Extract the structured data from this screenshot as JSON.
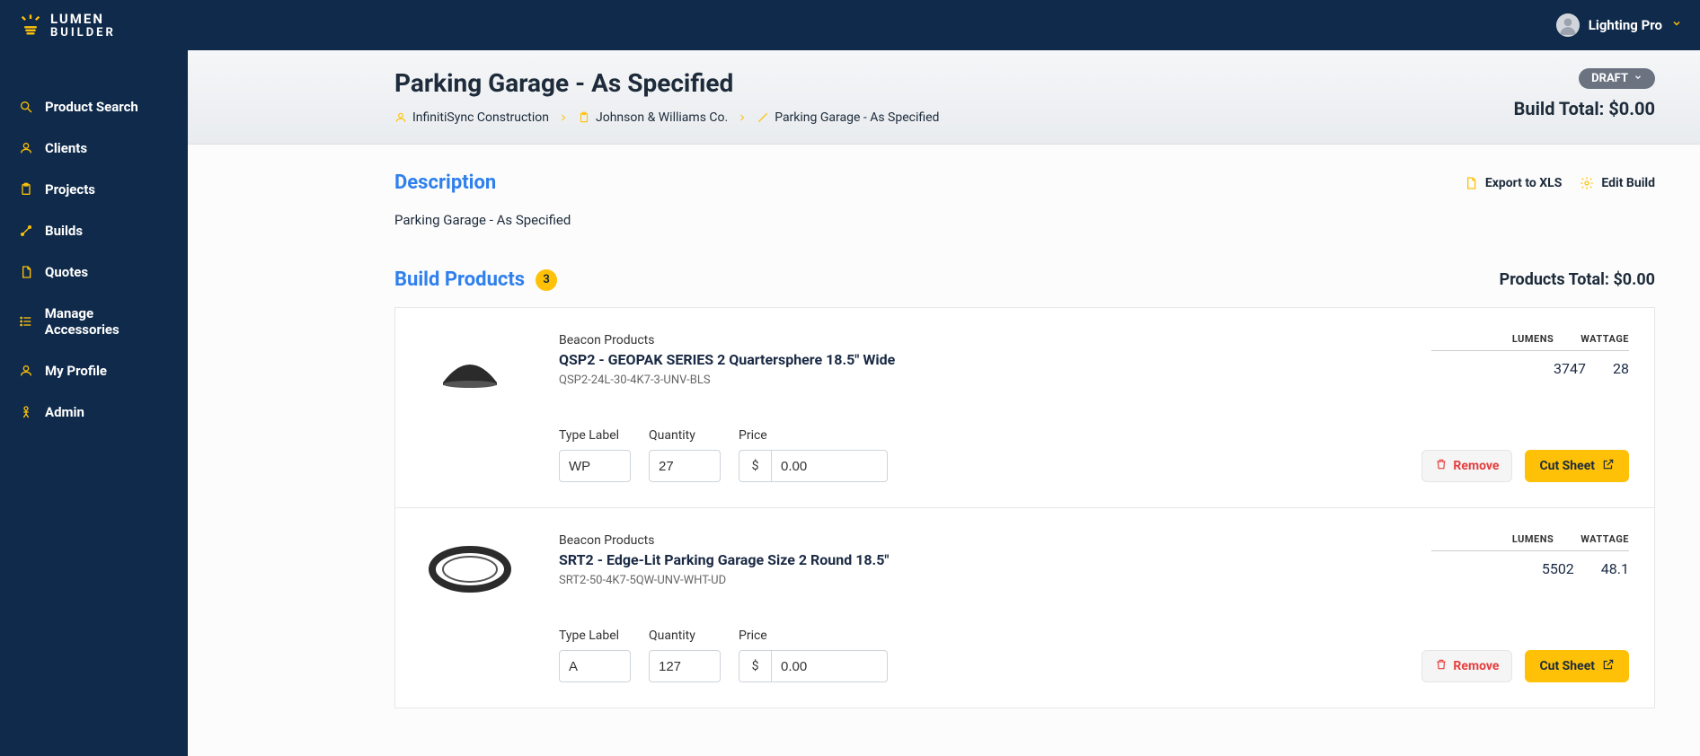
{
  "brand": {
    "line1": "LUMEN",
    "line2": "BUILDER"
  },
  "user": {
    "name": "Lighting Pro"
  },
  "sidebar": {
    "items": [
      {
        "label": "Product Search",
        "icon": "search"
      },
      {
        "label": "Clients",
        "icon": "user"
      },
      {
        "label": "Projects",
        "icon": "clipboard"
      },
      {
        "label": "Builds",
        "icon": "tools"
      },
      {
        "label": "Quotes",
        "icon": "file"
      },
      {
        "label": "Manage Accessories",
        "icon": "list"
      },
      {
        "label": "My Profile",
        "icon": "user"
      },
      {
        "label": "Admin",
        "icon": "person"
      }
    ]
  },
  "page": {
    "title": "Parking Garage - As Specified",
    "status": "DRAFT",
    "build_total_label": "Build Total:",
    "build_total_value": "$0.00"
  },
  "breadcrumbs": [
    {
      "label": "InfinitiSync Construction",
      "icon": "user"
    },
    {
      "label": "Johnson & Williams Co.",
      "icon": "clipboard"
    },
    {
      "label": "Parking Garage - As Specified",
      "icon": "tools"
    }
  ],
  "description": {
    "heading": "Description",
    "text": "Parking Garage - As Specified",
    "actions": {
      "export": "Export to XLS",
      "edit": "Edit Build"
    }
  },
  "build_products": {
    "heading": "Build Products",
    "count": "3",
    "total_label": "Products Total:",
    "total_value": "$0.00",
    "spec_headers": {
      "lumens": "LUMENS",
      "wattage": "WATTAGE"
    },
    "labels": {
      "type": "Type Label",
      "qty": "Quantity",
      "price": "Price",
      "price_prefix": "$"
    },
    "buttons": {
      "remove": "Remove",
      "cut": "Cut Sheet"
    },
    "items": [
      {
        "brand": "Beacon Products",
        "name": "QSP2 - GEOPAK SERIES 2 Quartersphere 18.5\" Wide",
        "sku": "QSP2-24L-30-4K7-3-UNV-BLS",
        "lumens": "3747",
        "wattage": "28",
        "type": "WP",
        "qty": "27",
        "price": "0.00",
        "thumb": "dome"
      },
      {
        "brand": "Beacon Products",
        "name": "SRT2 - Edge-Lit Parking Garage Size 2 Round 18.5\"",
        "sku": "SRT2-50-4K7-5QW-UNV-WHT-UD",
        "lumens": "5502",
        "wattage": "48.1",
        "type": "A",
        "qty": "127",
        "price": "0.00",
        "thumb": "ring"
      }
    ]
  }
}
